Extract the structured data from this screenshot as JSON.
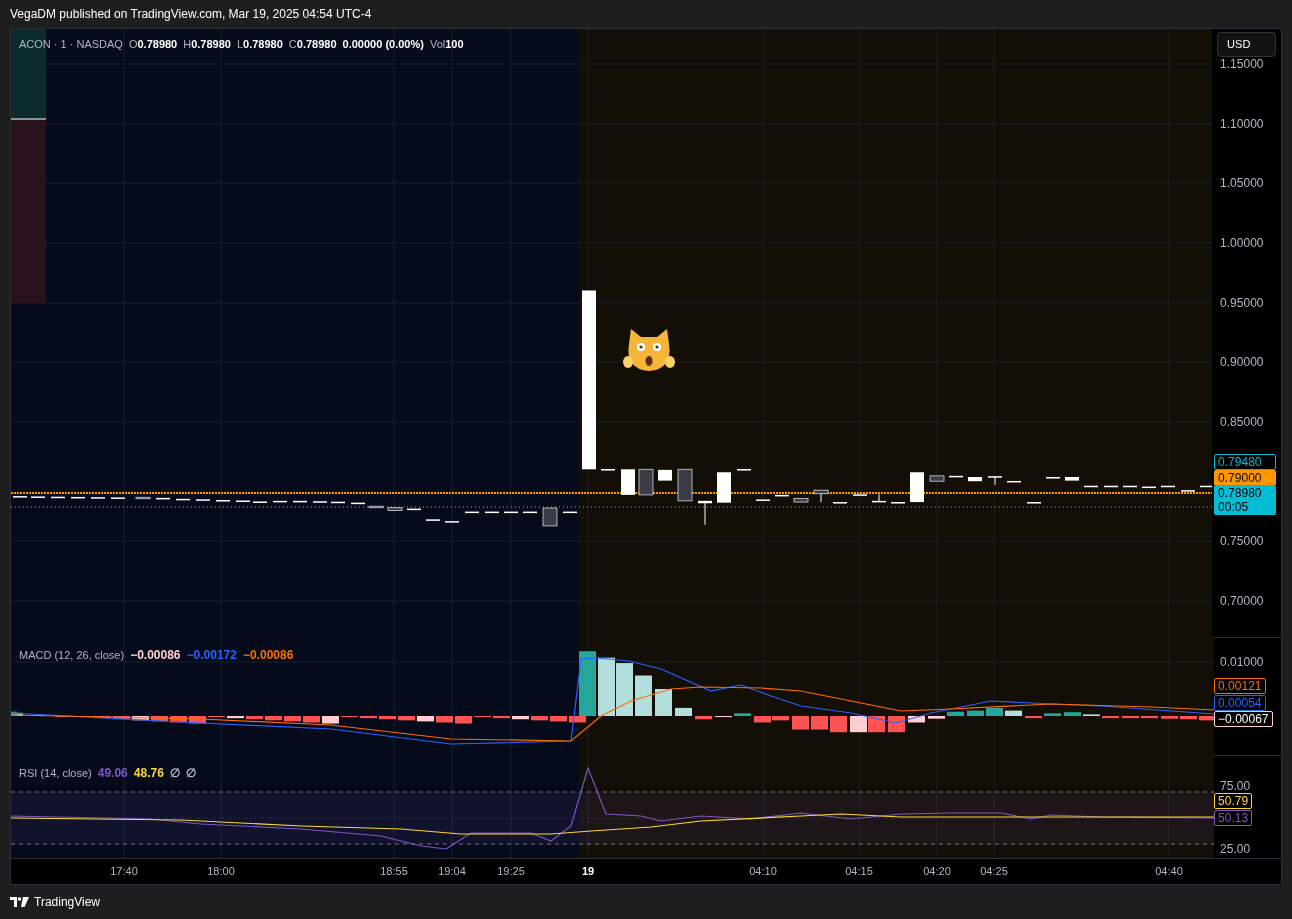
{
  "header": {
    "text": "VegaDM published on TradingView.com, Mar 19, 2025 04:54 UTC-4"
  },
  "legend": {
    "symbol": "ACON · 1 · NASDAQ",
    "ohlc": [
      {
        "label": "O",
        "value": "0.78980"
      },
      {
        "label": "H",
        "value": "0.78980"
      },
      {
        "label": "L",
        "value": "0.78980"
      },
      {
        "label": "C",
        "value": "0.78980"
      }
    ],
    "change": "0.00000 (0.00%)",
    "volume": {
      "label": "Vol",
      "value": "100"
    }
  },
  "currency_button": "USD",
  "price_axis": {
    "ticks": [
      "1.15000",
      "1.10000",
      "1.05000",
      "1.00000",
      "0.95000",
      "0.90000",
      "0.85000",
      "0.75000",
      "0.70000"
    ],
    "tags": [
      {
        "text": "0.79480",
        "kind": "outline",
        "color": "#00bcd4"
      },
      {
        "text": "0.79000",
        "kind": "filled",
        "color": "#ff9800"
      },
      {
        "text": "0.78980",
        "subtext": "00:05",
        "kind": "filled",
        "color": "#00bcd4"
      }
    ]
  },
  "macd": {
    "title": "MACD (12, 26, close)",
    "values": [
      {
        "text": "−0.00086",
        "color": "#ffcdd2"
      },
      {
        "text": "−0.00172",
        "color": "#2962ff"
      },
      {
        "text": "−0.00086",
        "color": "#ff6d00"
      }
    ],
    "ticks": [
      "0.01000"
    ],
    "tags": [
      {
        "text": "0.00121",
        "color": "#ff6d00"
      },
      {
        "text": "0.00054",
        "color": "#2962ff"
      },
      {
        "text": "−0.00067",
        "color": "#ffcdd2"
      }
    ]
  },
  "rsi": {
    "title": "RSI (14, close)",
    "values": [
      {
        "text": "49.06",
        "color": "#7e57c2"
      },
      {
        "text": "48.76",
        "color": "#fdd835"
      },
      {
        "text": "∅",
        "color": "#b2b5be"
      },
      {
        "text": "∅",
        "color": "#b2b5be"
      }
    ],
    "ticks": [
      "75.00",
      "25.00"
    ],
    "tags": [
      {
        "text": "50.79",
        "color": "#fdd835"
      },
      {
        "text": "50.13",
        "color": "#7e57c2"
      }
    ]
  },
  "time_axis": [
    {
      "text": "17:40",
      "kind": "time"
    },
    {
      "text": "18:00",
      "kind": "time"
    },
    {
      "text": "18:55",
      "kind": "time"
    },
    {
      "text": "19:04",
      "kind": "time"
    },
    {
      "text": "19:25",
      "kind": "time"
    },
    {
      "text": "19",
      "kind": "day"
    },
    {
      "text": "04:10",
      "kind": "time"
    },
    {
      "text": "04:15",
      "kind": "time"
    },
    {
      "text": "04:20",
      "kind": "time"
    },
    {
      "text": "04:25",
      "kind": "time"
    },
    {
      "text": "04:40",
      "kind": "time"
    }
  ],
  "footer": {
    "brand": "TradingView"
  }
}
